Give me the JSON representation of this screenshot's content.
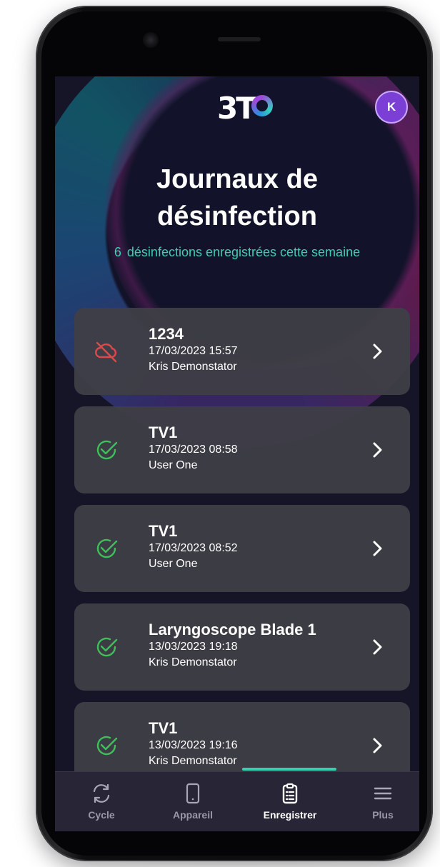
{
  "header": {
    "logo_text": "3T",
    "avatar_initial": "K",
    "title_line1": "Journaux de",
    "title_line2": "désinfection",
    "week_count": "6",
    "week_text": "désinfections enregistrées cette semaine"
  },
  "records": [
    {
      "name": "1234",
      "date": "17/03/2023 15:57",
      "user": "Kris Demonstator",
      "status": "failed",
      "icon": "cloud-off-icon"
    },
    {
      "name": "TV1",
      "date": "17/03/2023 08:58",
      "user": "User One",
      "status": "success",
      "icon": "check-circle-icon"
    },
    {
      "name": "TV1",
      "date": "17/03/2023 08:52",
      "user": "User One",
      "status": "success",
      "icon": "check-circle-icon"
    },
    {
      "name": "Laryngoscope Blade 1",
      "date": "13/03/2023 19:18",
      "user": "Kris Demonstator",
      "status": "success",
      "icon": "check-circle-icon"
    },
    {
      "name": "TV1",
      "date": "13/03/2023 19:16",
      "user": "Kris Demonstator",
      "status": "success",
      "icon": "check-circle-icon"
    }
  ],
  "nav": {
    "items": [
      {
        "label": "Cycle",
        "icon": "refresh-icon"
      },
      {
        "label": "Appareil",
        "icon": "device-icon"
      },
      {
        "label": "Enregistrer",
        "icon": "clipboard-icon"
      },
      {
        "label": "Plus",
        "icon": "menu-icon"
      }
    ],
    "active": "Enregistrer"
  },
  "colors": {
    "background": "#161528",
    "card": "#3e3e46",
    "accent_teal": "#39d0b2",
    "success_green": "#3fbf5a",
    "error_red": "#e0474a",
    "avatar_purple": "#7b3fd6"
  }
}
